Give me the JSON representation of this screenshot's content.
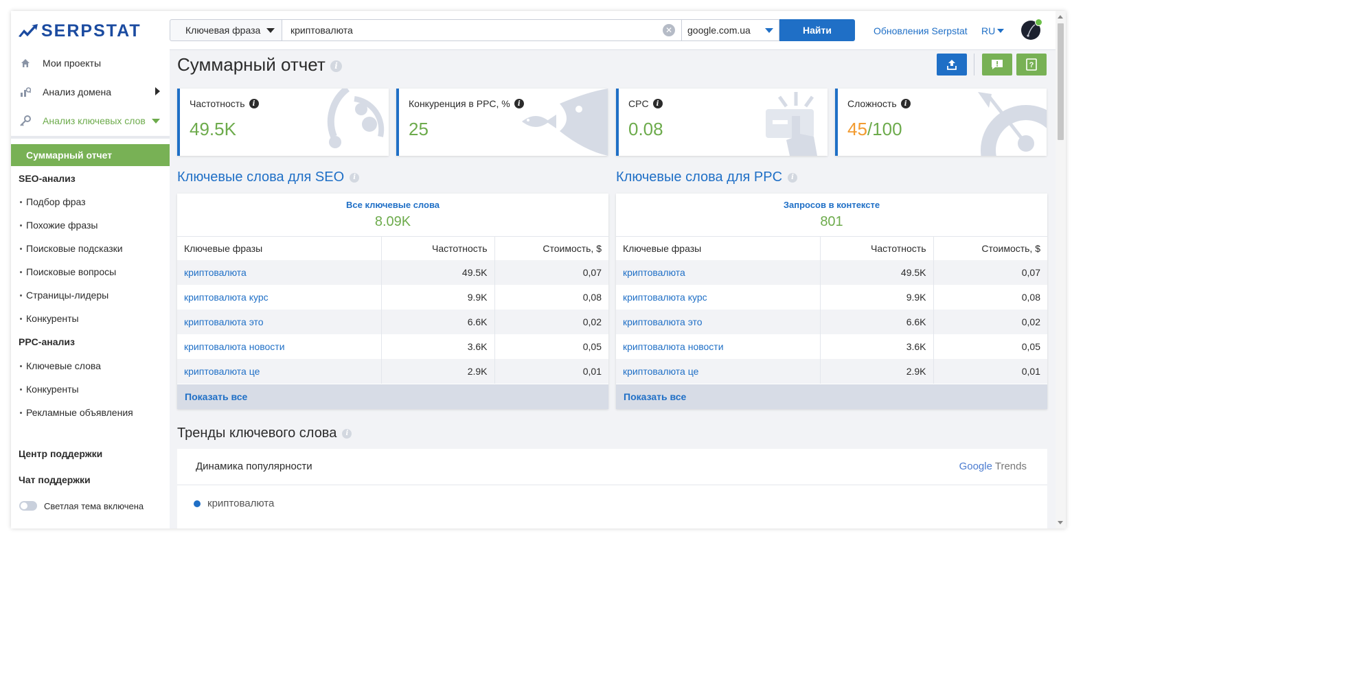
{
  "app": {
    "brand": "SERPSTAT"
  },
  "sidebar": {
    "nav": [
      {
        "label": "Мои проекты",
        "icon": "home-icon"
      },
      {
        "label": "Анализ домена",
        "icon": "domain-analysis-icon"
      },
      {
        "label": "Анализ ключевых слов",
        "icon": "key-icon"
      }
    ],
    "active_sub": "Суммарный отчет",
    "seo_head": "SEO-анализ",
    "seo_items": [
      "Подбор фраз",
      "Похожие фразы",
      "Поисковые подсказки",
      "Поисковые вопросы",
      "Страницы-лидеры",
      "Конкуренты"
    ],
    "ppc_head": "PPC-анализ",
    "ppc_items": [
      "Ключевые слова",
      "Конкуренты",
      "Рекламные объявления"
    ],
    "support_center": "Центр поддержки",
    "support_chat": "Чат поддержки",
    "theme_toggle": "Светлая тема включена"
  },
  "header": {
    "search_type": "Ключевая фраза",
    "query": "криптовалюта",
    "search_engine": "google.com.ua",
    "find_label": "Найти",
    "updates_label": "Обновления Serpstat",
    "lang": "RU"
  },
  "page": {
    "title": "Суммарный отчет",
    "cards": [
      {
        "label": "Частотность",
        "value": "49.5K"
      },
      {
        "label": "Конкуренция в PPC, %",
        "value": "25"
      },
      {
        "label": "CPC",
        "value": "0.08"
      },
      {
        "label": "Сложность",
        "value_main": "45",
        "value_rest": "/100"
      }
    ],
    "seo_panel": {
      "title": "Ключевые слова для SEO",
      "summary_label": "Все ключевые слова",
      "summary_value": "8.09K",
      "columns": [
        "Ключевые фразы",
        "Частотность",
        "Стоимость, $"
      ],
      "rows": [
        {
          "kw": "криптовалюта",
          "freq": "49.5K",
          "cost": "0,07"
        },
        {
          "kw": "криптовалюта курс",
          "freq": "9.9K",
          "cost": "0,08"
        },
        {
          "kw": "криптовалюта это",
          "freq": "6.6K",
          "cost": "0,02"
        },
        {
          "kw": "криптовалюта новости",
          "freq": "3.6K",
          "cost": "0,05"
        },
        {
          "kw": "криптовалюта це",
          "freq": "2.9K",
          "cost": "0,01"
        }
      ],
      "show_all": "Показать все"
    },
    "ppc_panel": {
      "title": "Ключевые слова для PPC",
      "summary_label": "Запросов в контексте",
      "summary_value": "801",
      "columns": [
        "Ключевые фразы",
        "Частотность",
        "Стоимость, $"
      ],
      "rows": [
        {
          "kw": "криптовалюта",
          "freq": "49.5K",
          "cost": "0,07"
        },
        {
          "kw": "криптовалюта курс",
          "freq": "9.9K",
          "cost": "0,08"
        },
        {
          "kw": "криптовалюта это",
          "freq": "6.6K",
          "cost": "0,02"
        },
        {
          "kw": "криптовалюта новости",
          "freq": "3.6K",
          "cost": "0,05"
        },
        {
          "kw": "криптовалюта це",
          "freq": "2.9K",
          "cost": "0,01"
        }
      ],
      "show_all": "Показать все"
    },
    "trends": {
      "title": "Тренды ключевого слова",
      "subtitle": "Динамика популярности",
      "brand_google": "Google",
      "brand_trends": "Trends",
      "legend": "криптовалюта"
    }
  },
  "colors": {
    "accent": "#1f6fc6",
    "green": "#6dab4c",
    "orange": "#f29b30",
    "action_green": "#78b155"
  }
}
